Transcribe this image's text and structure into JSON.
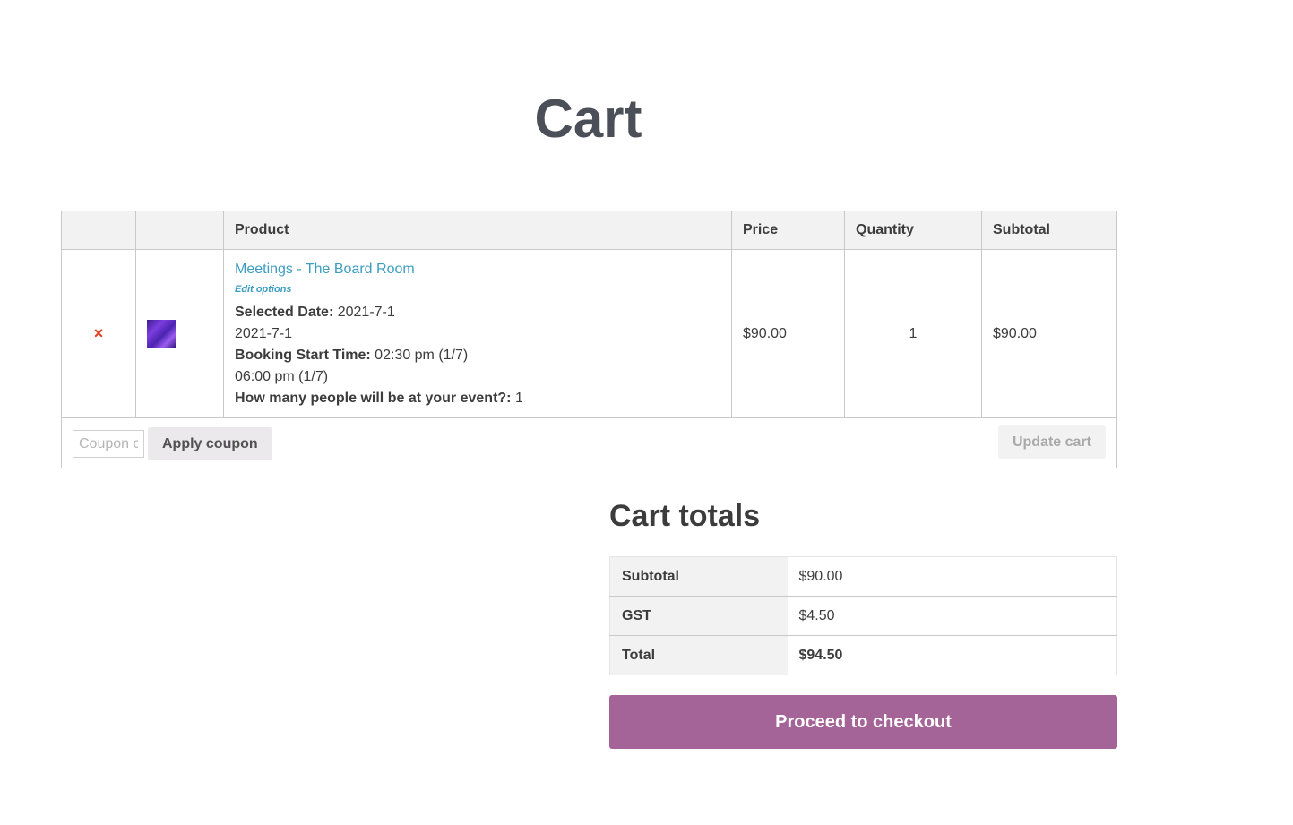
{
  "page": {
    "title": "Cart"
  },
  "cart_table": {
    "headers": {
      "remove": "",
      "thumbnail": "",
      "product": "Product",
      "price": "Price",
      "quantity": "Quantity",
      "subtotal": "Subtotal"
    },
    "items": [
      {
        "remove_icon": "×",
        "thumbnail_icon": "product-thumbnail",
        "product_name": "Meetings - The Board Room",
        "edit_label": "Edit options",
        "meta": {
          "selected_date_label": "Selected Date:",
          "selected_date_value": "2021-7-1",
          "date_line": "2021-7-1",
          "start_time_label": "Booking Start Time:",
          "start_time_value": "02:30 pm (1/7)",
          "end_time_line": "06:00 pm (1/7)",
          "people_label": "How many people will be at your event?:",
          "people_value": "1"
        },
        "price": "$90.00",
        "quantity": "1",
        "subtotal": "$90.00"
      }
    ],
    "actions": {
      "coupon_placeholder": "Coupon code",
      "apply_coupon_label": "Apply coupon",
      "update_cart_label": "Update cart"
    }
  },
  "cart_totals": {
    "title": "Cart totals",
    "rows": [
      {
        "label": "Subtotal",
        "value": "$90.00"
      },
      {
        "label": "GST",
        "value": "$4.50"
      },
      {
        "label": "Total",
        "value": "$94.50"
      }
    ],
    "checkout_label": "Proceed to checkout"
  },
  "colors": {
    "accent": "#a46497",
    "link": "#3a9dc1",
    "remove": "#e2401c"
  }
}
